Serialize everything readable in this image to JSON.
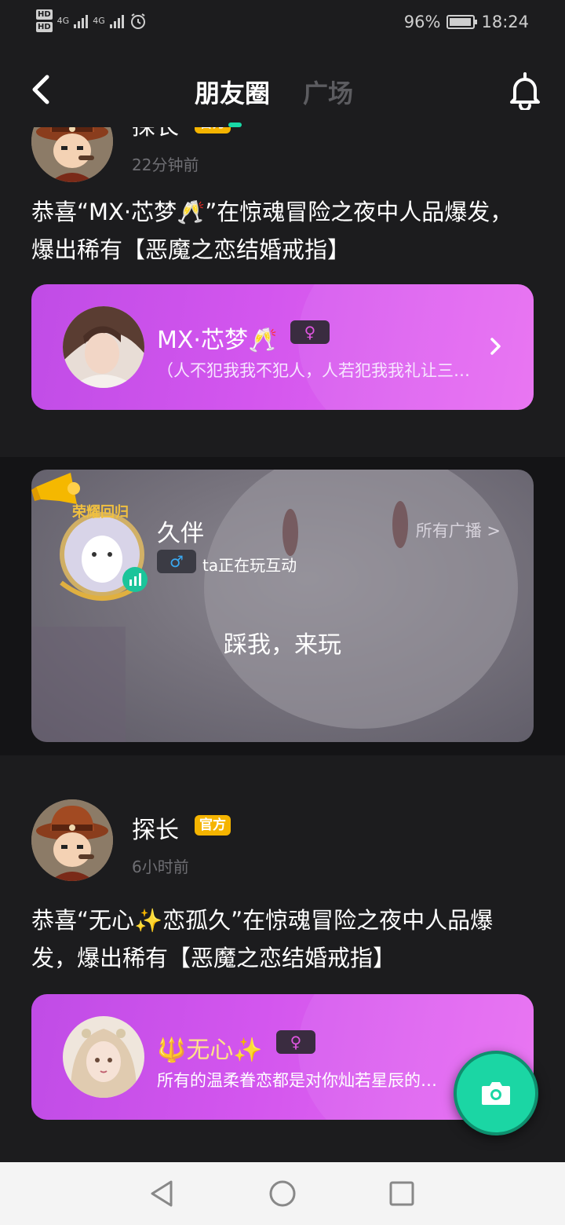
{
  "status_bar": {
    "hd1": "HD",
    "hd2": "HD",
    "net1": "4G",
    "net2": "4G",
    "battery": "96%",
    "time": "18:24"
  },
  "header": {
    "tab_active": "朋友圈",
    "tab_inactive": "广场"
  },
  "post1": {
    "author": "探长",
    "badge": "官方",
    "time": "22分钟前",
    "text": "恭喜“MX·芯梦🥂”在惊魂冒险之夜中人品爆发，爆出稀有【恶魔之恋结婚戒指】",
    "card": {
      "name": "MX·芯梦🥂",
      "gender": "♀",
      "sign": "（人不犯我我不犯人，人若犯我我礼让三分）"
    }
  },
  "broadcast": {
    "name": "久伴",
    "all_link": "所有广播 >",
    "gender": "♂",
    "status": "ta正在玩互动",
    "message": "踩我，来玩",
    "frame_text": "荣耀回归"
  },
  "post2": {
    "author": "探长",
    "badge": "官方",
    "time": "6小时前",
    "text": "恭喜“无心✨恋孤久”在惊魂冒险之夜中人品爆发，爆出稀有【恶魔之恋结婚戒指】",
    "card": {
      "name": "🔱无心✨",
      "gender": "♀",
      "sign": "所有的温柔眷恋都是对你灿若星辰的回应"
    }
  },
  "colors": {
    "accent": "#19d9a6",
    "badge": "#f5b400",
    "card_gradient_start": "#c04ce6",
    "card_gradient_end": "#e86cf2",
    "background": "#1c1c1e"
  }
}
